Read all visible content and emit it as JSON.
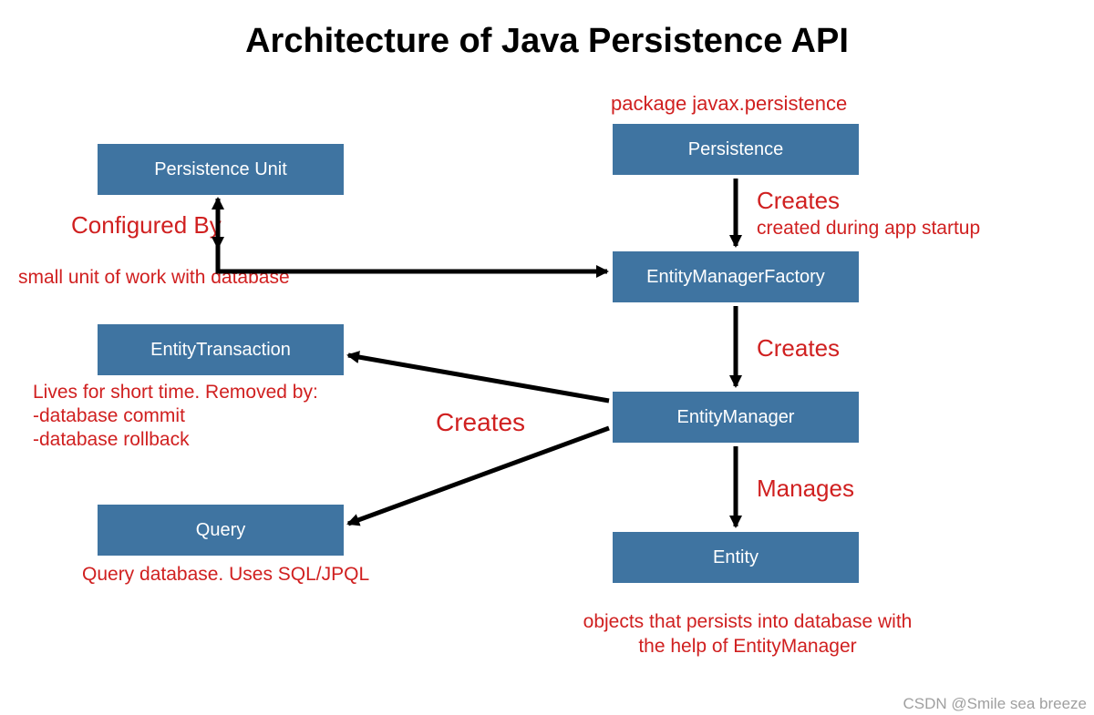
{
  "title": "Architecture of Java Persistence API",
  "boxes": {
    "persistence_unit": "Persistence Unit",
    "entity_transaction": "EntityTransaction",
    "query": "Query",
    "persistence": "Persistence",
    "emf": "EntityManagerFactory",
    "em": "EntityManager",
    "entity": "Entity"
  },
  "notes": {
    "package": "package javax.persistence",
    "creates_emf": "Creates",
    "startup": "created during app startup",
    "configured_by": "Configured By",
    "small_unit": "small unit of work with database",
    "creates_em": "Creates",
    "creates_left": "Creates",
    "tx_life_1": "Lives for short time. Removed by:",
    "tx_life_2": "-database commit",
    "tx_life_3": "-database rollback",
    "query_desc": "Query database. Uses SQL/JPQL",
    "manages": "Manages",
    "entity_desc_1": "objects that persists into database with",
    "entity_desc_2": "the help of EntityManager"
  },
  "watermark": "CSDN @Smile sea breeze"
}
